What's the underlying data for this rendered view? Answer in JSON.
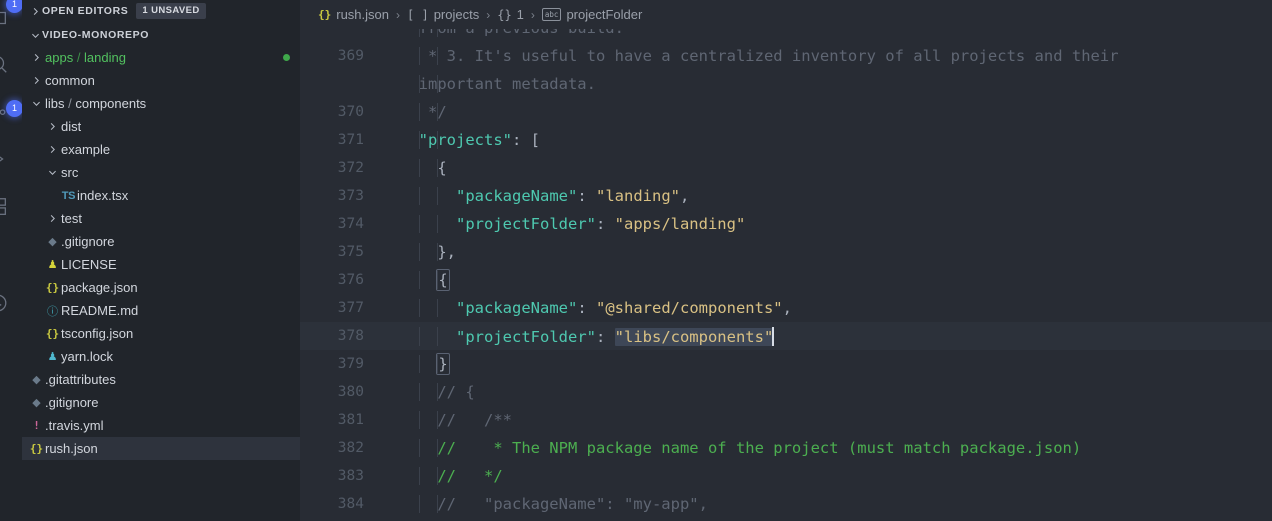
{
  "theme": {
    "editor_bg": "#282c34",
    "sidebar_bg": "#21252b",
    "accent_blue": "#4f6df5",
    "dirty_green": "#3fa84b",
    "key_teal": "#4ec9b0",
    "string_tan": "#d9c184",
    "comment_gray": "#5f6673",
    "comment_green": "#4caf50",
    "selection": "#3e4757",
    "current_line": "#2c313a"
  },
  "activitybar": {
    "items": [
      {
        "name": "explorer-icon",
        "badge": "1"
      },
      {
        "name": "search-icon",
        "badge": ""
      },
      {
        "name": "source-control-icon",
        "badge": "1"
      },
      {
        "name": "run-and-debug-icon",
        "badge": ""
      },
      {
        "name": "extensions-icon",
        "badge": ""
      },
      {
        "name": "remote-explorer-icon",
        "badge": ""
      },
      {
        "name": "timeline-icon",
        "badge": ""
      }
    ]
  },
  "sidebar": {
    "open_editors": {
      "label": "Open Editors",
      "badge": "1 Unsaved",
      "expanded": false
    },
    "workspace": {
      "label": "VIDEO-MONOREPO",
      "expanded": true
    },
    "tree": [
      {
        "label": "apps / landing",
        "label_prefix": "apps",
        "label_suffix": "landing",
        "icon": "chevron-right-icon",
        "type": "folder",
        "indent": 1,
        "expanded": false,
        "green": true,
        "dirty": true
      },
      {
        "label": "common",
        "icon": "chevron-right-icon",
        "type": "folder",
        "indent": 1,
        "expanded": false,
        "green": false,
        "dirty": false
      },
      {
        "label": "libs / components",
        "label_prefix": "libs",
        "label_suffix": "components",
        "icon": "chevron-down-icon",
        "type": "folder",
        "indent": 1,
        "expanded": true,
        "green": false,
        "dirty": false
      },
      {
        "label": "dist",
        "icon": "chevron-right-icon",
        "type": "folder",
        "indent": 2,
        "expanded": false
      },
      {
        "label": "example",
        "icon": "chevron-right-icon",
        "type": "folder",
        "indent": 2,
        "expanded": false
      },
      {
        "label": "src",
        "icon": "chevron-down-icon",
        "type": "folder",
        "indent": 2,
        "expanded": true
      },
      {
        "label": "index.tsx",
        "icon": "typescript-react-icon",
        "icon_text": "TS",
        "type": "file",
        "indent": 3
      },
      {
        "label": "test",
        "icon": "chevron-right-icon",
        "type": "folder",
        "indent": 2,
        "expanded": false
      },
      {
        "label": ".gitignore",
        "icon": "git-icon",
        "icon_text": "◆",
        "type": "file",
        "indent": 2
      },
      {
        "label": "LICENSE",
        "icon": "license-icon",
        "icon_text": "♟",
        "type": "file",
        "indent": 2
      },
      {
        "label": "package.json",
        "icon": "json-icon",
        "icon_text": "{}",
        "type": "file",
        "indent": 2
      },
      {
        "label": "README.md",
        "icon": "info-icon",
        "icon_text": "ⓘ",
        "type": "file",
        "indent": 2
      },
      {
        "label": "tsconfig.json",
        "icon": "json-icon",
        "icon_text": "{}",
        "type": "file",
        "indent": 2
      },
      {
        "label": "yarn.lock",
        "icon": "yarn-icon",
        "icon_text": "♟",
        "type": "file",
        "indent": 2
      },
      {
        "label": ".gitattributes",
        "icon": "git-icon",
        "icon_text": "◆",
        "type": "file",
        "indent": 1
      },
      {
        "label": ".gitignore",
        "icon": "git-icon",
        "icon_text": "◆",
        "type": "file",
        "indent": 1
      },
      {
        "label": ".travis.yml",
        "icon": "travis-icon",
        "icon_text": "!",
        "type": "file",
        "indent": 1
      },
      {
        "label": "rush.json",
        "icon": "json-icon",
        "icon_text": "{}",
        "type": "file",
        "indent": 1,
        "selected": true
      }
    ]
  },
  "breadcrumbs": {
    "items": [
      {
        "icon": "json-icon",
        "icon_text": "{}",
        "label": "rush.json"
      },
      {
        "icon": "array-icon",
        "icon_text": "[ ]",
        "label": "projects"
      },
      {
        "icon": "object-icon",
        "icon_text": "{}",
        "label": "1"
      },
      {
        "icon": "string-icon",
        "icon_text": "abc",
        "label": "projectFolder"
      }
    ],
    "separator": "›"
  },
  "code": {
    "lines": [
      {
        "num": "",
        "clipped": true,
        "tokens": [
          {
            "t": "  from a previous build.",
            "c": "comment"
          }
        ]
      },
      {
        "num": "369",
        "tokens": [
          {
            "t": "   * 3. It's useful to have a centralized inventory of all projects and their",
            "c": "comment"
          }
        ]
      },
      {
        "num": "",
        "wrap": true,
        "tokens": [
          {
            "t": "  important metadata.",
            "c": "comment"
          }
        ]
      },
      {
        "num": "370",
        "tokens": [
          {
            "t": "   */",
            "c": "comment"
          }
        ]
      },
      {
        "num": "371",
        "tokens": [
          {
            "t": "  ",
            "c": "plain"
          },
          {
            "t": "\"projects\"",
            "c": "key"
          },
          {
            "t": ": [",
            "c": "punct"
          }
        ]
      },
      {
        "num": "372",
        "tokens": [
          {
            "t": "    {",
            "c": "punct"
          }
        ]
      },
      {
        "num": "373",
        "tokens": [
          {
            "t": "      ",
            "c": "plain"
          },
          {
            "t": "\"packageName\"",
            "c": "key"
          },
          {
            "t": ": ",
            "c": "punct"
          },
          {
            "t": "\"landing\"",
            "c": "str"
          },
          {
            "t": ",",
            "c": "punct"
          }
        ]
      },
      {
        "num": "374",
        "tokens": [
          {
            "t": "      ",
            "c": "plain"
          },
          {
            "t": "\"projectFolder\"",
            "c": "key"
          },
          {
            "t": ": ",
            "c": "punct"
          },
          {
            "t": "\"apps/landing\"",
            "c": "str"
          }
        ]
      },
      {
        "num": "375",
        "tokens": [
          {
            "t": "    },",
            "c": "punct"
          }
        ]
      },
      {
        "num": "376",
        "bracket_open": true,
        "tokens": [
          {
            "t": "    ",
            "c": "plain"
          },
          {
            "t": "{",
            "c": "punct",
            "box": true
          }
        ]
      },
      {
        "num": "377",
        "tokens": [
          {
            "t": "      ",
            "c": "plain"
          },
          {
            "t": "\"packageName\"",
            "c": "key"
          },
          {
            "t": ": ",
            "c": "punct"
          },
          {
            "t": "\"@shared/components\"",
            "c": "str"
          },
          {
            "t": ",",
            "c": "punct"
          }
        ]
      },
      {
        "num": "378",
        "current": true,
        "tokens": [
          {
            "t": "      ",
            "c": "plain"
          },
          {
            "t": "\"projectFolder\"",
            "c": "key"
          },
          {
            "t": ": ",
            "c": "punct"
          },
          {
            "t": "\"libs/components\"",
            "c": "str",
            "sel": true
          },
          {
            "t": "",
            "c": "cursor"
          }
        ]
      },
      {
        "num": "379",
        "bracket_close": true,
        "tokens": [
          {
            "t": "    ",
            "c": "plain"
          },
          {
            "t": "}",
            "c": "punct",
            "box": true
          }
        ]
      },
      {
        "num": "380",
        "tokens": [
          {
            "t": "    // {",
            "c": "comment"
          }
        ]
      },
      {
        "num": "381",
        "tokens": [
          {
            "t": "    //   /**",
            "c": "comment"
          }
        ]
      },
      {
        "num": "382",
        "tokens": [
          {
            "t": "    //    * The NPM package name of the project (must match package.json)",
            "c": "comment-bright"
          }
        ]
      },
      {
        "num": "383",
        "tokens": [
          {
            "t": "    //   */",
            "c": "comment-bright"
          }
        ]
      },
      {
        "num": "384",
        "tokens": [
          {
            "t": "    //   \"packageName\": \"my-app\",",
            "c": "comment"
          }
        ]
      }
    ]
  }
}
